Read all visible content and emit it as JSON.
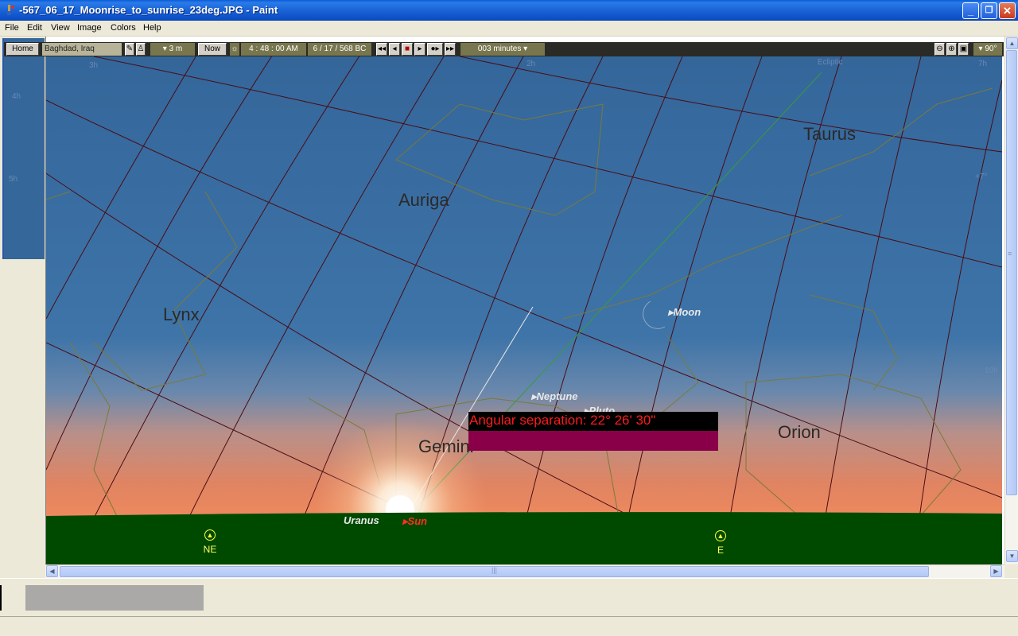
{
  "window": {
    "title": "-567_06_17_Moonrise_to_sunrise_23deg.JPG - Paint",
    "minimize": "_",
    "maximize": "❐",
    "close": "✕"
  },
  "menu": {
    "items": [
      "File",
      "Edit",
      "View",
      "Image",
      "Colors",
      "Help"
    ]
  },
  "sky_toolbar": {
    "home": "Home",
    "location": "Baghdad, Iraq",
    "elevation": "▾ 3 m",
    "now": "Now",
    "time": "4 : 48 : 00 AM",
    "date": "6 / 17 /   568 BC",
    "step": "003 minutes ▾",
    "fov": "▾ 90°"
  },
  "sky": {
    "constellations": [
      "Taurus",
      "Auriga",
      "Lynx",
      "Gemini",
      "Orion"
    ],
    "objects": {
      "moon": "Moon",
      "neptune": "Neptune",
      "pluto": "Pluto",
      "uranus": "Uranus",
      "sun": "Sun"
    },
    "ecliptic_label": "Ecliptic",
    "separation": "Angular separation: 22° 26' 30\"",
    "compass": {
      "ne": "NE",
      "e": "E"
    },
    "edge_labels": [
      "3h",
      "4h",
      "5h",
      "2h",
      "7h",
      "+7°",
      "10h"
    ]
  },
  "colors": {
    "sky_top": "#34669a",
    "sky_mid": "#5a88b8",
    "horizon_glow": "#e88058",
    "ground": "#004a00",
    "grid_lines": "#5a1010",
    "constellation_lines": "#7a7a3a"
  }
}
